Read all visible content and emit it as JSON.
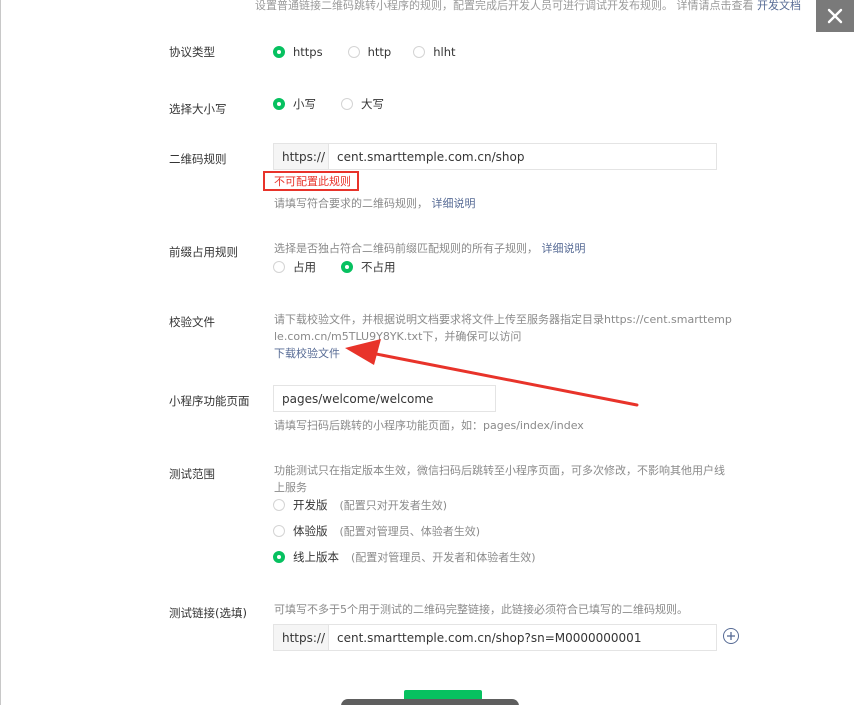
{
  "intro": {
    "text": "设置普通链接二维码跳转小程序的规则，配置完成后开发人员可进行调试开发布规则。 详情请点击查看",
    "link": "开发文档"
  },
  "protocol": {
    "label": "协议类型",
    "options": [
      "https",
      "http",
      "hlht"
    ],
    "selected": "https"
  },
  "case": {
    "label": "选择大小写",
    "options": [
      "小写",
      "大写"
    ],
    "selected": "小写"
  },
  "qr_rule": {
    "label": "二维码规则",
    "prefix": "https://",
    "value": "cent.smarttemple.com.cn/shop",
    "error": "不可配置此规则",
    "hint": "请填写符合要求的二维码规则，",
    "hint_link": "详细说明"
  },
  "prefix_rule": {
    "label": "前缀占用规则",
    "hint": "选择是否独占符合二维码前缀匹配规则的所有子规则，",
    "hint_link": "详细说明",
    "options": [
      "占用",
      "不占用"
    ],
    "selected": "不占用"
  },
  "verify_file": {
    "label": "校验文件",
    "text_line1": "请下载校验文件，并根据说明文档要求将文件上传至服务器指定目录https://cent.smarttemp",
    "text_line2": "le.com.cn/m5TLU9Y8YK.txt下，并确保可以访问",
    "download_link": "下载校验文件"
  },
  "page_path": {
    "label": "小程序功能页面",
    "value": "pages/welcome/welcome",
    "hint": "请填写扫码后跳转的小程序功能页面，如：pages/index/index"
  },
  "test_scope": {
    "label": "测试范围",
    "hint_line1": "功能测试只在指定版本生效，微信扫码后跳转至小程序页面，可多次修改，不影响其他用户线",
    "hint_line2": "上服务",
    "options": [
      {
        "name": "开发版",
        "note": "(配置只对开发者生效)"
      },
      {
        "name": "体验版",
        "note": "(配置对管理员、体验者生效)"
      },
      {
        "name": "线上版本",
        "note": "(配置对管理员、开发者和体验者生效)"
      }
    ],
    "selected": "线上版本"
  },
  "test_link": {
    "label": "测试链接(选填)",
    "hint": "可填写不多于5个用于测试的二维码完整链接，此链接必须符合已填写的二维码规则。",
    "prefix": "https://",
    "value": "cent.smarttemple.com.cn/shop?sn=M0000000001"
  },
  "colors": {
    "accent": "#07c160",
    "link": "#576b95",
    "error": "#e8332a",
    "arrow": "#e8332a"
  }
}
